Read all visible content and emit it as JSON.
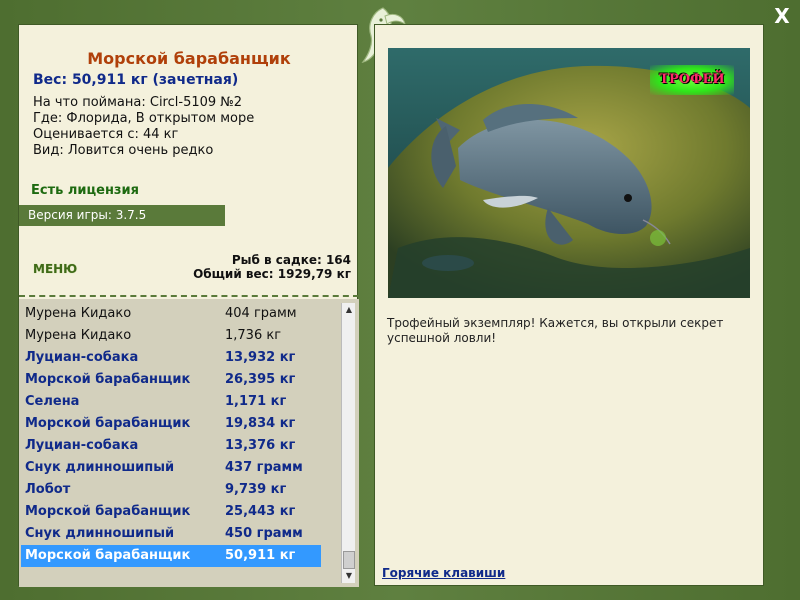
{
  "fish": {
    "title": "Морской барабанщик",
    "weight": "Вес: 50,911 кг (зачетная)",
    "caught_with": "На что поймана: Circl-5109 №2",
    "location": "Где: Флорида, В открытом море",
    "valued_from": "Оценивается с: 44 кг",
    "rarity": "Вид: Ловится очень редко"
  },
  "license": "Есть лицензия",
  "version": "Версия игры: 3.7.5",
  "menu_label": "МЕНЮ",
  "stats": {
    "fish_count": "Рыб в садке: 164",
    "total_weight": "Общий вес: 1929,79 кг"
  },
  "catch_list": [
    {
      "name": "Мурена Кидако",
      "weight": "404 грамм",
      "style": "plain"
    },
    {
      "name": "Мурена Кидако",
      "weight": "1,736 кг",
      "style": "plain"
    },
    {
      "name": "Луциан-собака",
      "weight": "13,932 кг",
      "style": "bold"
    },
    {
      "name": "Морской барабанщик",
      "weight": "26,395 кг",
      "style": "bold"
    },
    {
      "name": "Селена",
      "weight": "1,171 кг",
      "style": "bold"
    },
    {
      "name": "Морской барабанщик",
      "weight": "19,834 кг",
      "style": "bold"
    },
    {
      "name": "Луциан-собака",
      "weight": "13,376 кг",
      "style": "bold"
    },
    {
      "name": "Снук длинношипый",
      "weight": "437 грамм",
      "style": "bold"
    },
    {
      "name": "Лобот",
      "weight": "9,739 кг",
      "style": "bold"
    },
    {
      "name": "Морской барабанщик",
      "weight": "25,443 кг",
      "style": "bold"
    },
    {
      "name": "Снук длинношипый",
      "weight": "450 грамм",
      "style": "bold"
    },
    {
      "name": "Морской барабанщик",
      "weight": "50,911 кг",
      "style": "selected"
    }
  ],
  "trophy_badge": "ТРОФЕЙ",
  "description": "Трофейный экземпляр! Кажется, вы открыли секрет успешной ловли!",
  "hotkeys_label": "Горячие клавиши",
  "close_label": "X",
  "colors": {
    "frame": "#5a7a3a",
    "panel": "#f4f1dc",
    "title": "#b0400a",
    "accent_blue": "#102a8a",
    "selection": "#3399ff"
  }
}
